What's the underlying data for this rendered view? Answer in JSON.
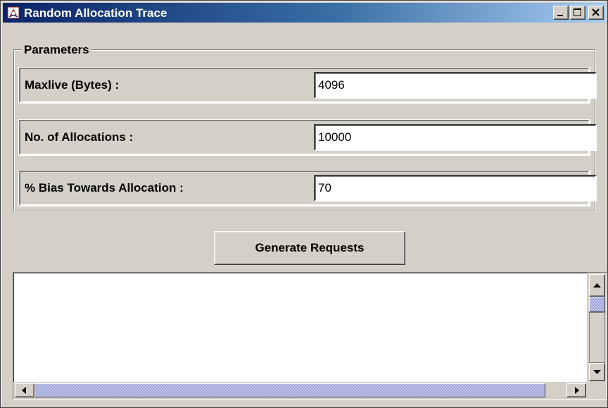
{
  "window": {
    "title": "Random Allocation Trace",
    "icons": {
      "app": "java-duke-icon",
      "minimize": "minimize-icon",
      "maximize": "maximize-icon",
      "close": "close-icon"
    },
    "colors": {
      "titlebar_start": "#0a246a",
      "titlebar_end": "#a6caf0",
      "face": "#d4d0c8"
    }
  },
  "parameters": {
    "group_label": "Parameters",
    "fields": [
      {
        "label": "Maxlive (Bytes) :",
        "value": "4096"
      },
      {
        "label": "No. of Allocations :",
        "value": "10000"
      },
      {
        "label": "% Bias Towards Allocation :",
        "value": "70"
      }
    ]
  },
  "actions": {
    "generate_label": "Generate Requests"
  },
  "output": {
    "text": ""
  }
}
